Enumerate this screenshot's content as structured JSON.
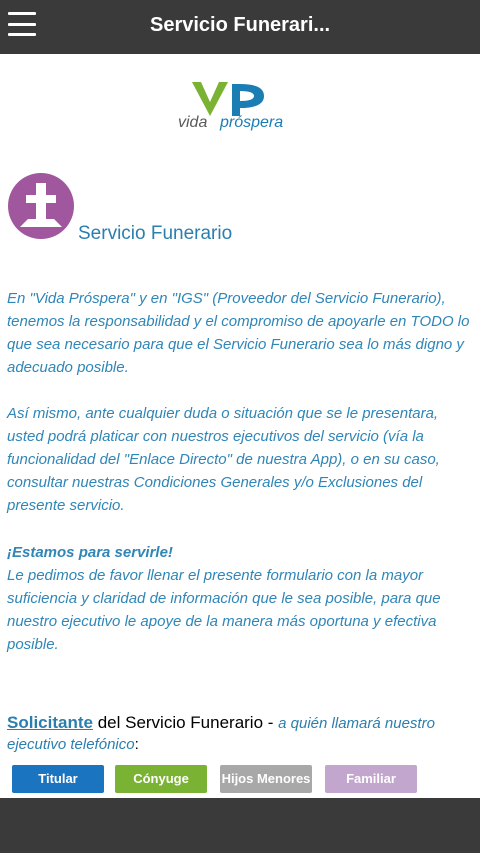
{
  "header": {
    "title": "Servicio Funerari..."
  },
  "logo": {
    "mark": "VP",
    "word1": "vida",
    "word2": "próspera"
  },
  "section": {
    "title": "Servicio Funerario"
  },
  "paragraphs": {
    "p1": "En \"Vida Próspera\" y en \"IGS\" (Proveedor del Servicio Funerario), tenemos la responsabilidad y el compromiso de apoyarle en TODO lo que sea necesario para que el Servicio Funerario sea lo más digno y adecuado posible.",
    "p2": "Así mismo, ante cualquier duda o situación que se le presentara, usted podrá platicar con nuestros ejecutivos del servicio (vía la funcionalidad del \"Enlace Directo\" de nuestra App), o en su caso, consultar nuestras Condiciones Generales y/o Exclusiones del presente servicio.",
    "p3_heading": "¡Estamos para servirle!",
    "p3": "Le pedimos de favor llenar el presente formulario con la mayor suficiencia y claridad de información que le sea posible, para que nuestro ejecutivo le apoye de la manera más oportuna y efectiva posible."
  },
  "solicitante": {
    "link": "Solicitante",
    "text": " del Servicio Funerario - ",
    "hint": "a quién llamará nuestro",
    "hint2": "ejecutivo telefónico",
    "colon": ":"
  },
  "tabs": [
    "Titular",
    "Cónyuge",
    "Hijos Menores",
    "Familiar"
  ],
  "colors": {
    "topbar": "#3a3a3a",
    "accent": "#2b7fae",
    "icon_bg": "#a0579d",
    "titular": "#1b74c0",
    "conyuge": "#7ab334",
    "hijos": "#a8a8a8",
    "familiar": "#c3a6ce"
  },
  "icons": {
    "menu": "hamburger-icon",
    "section": "cross-icon"
  }
}
